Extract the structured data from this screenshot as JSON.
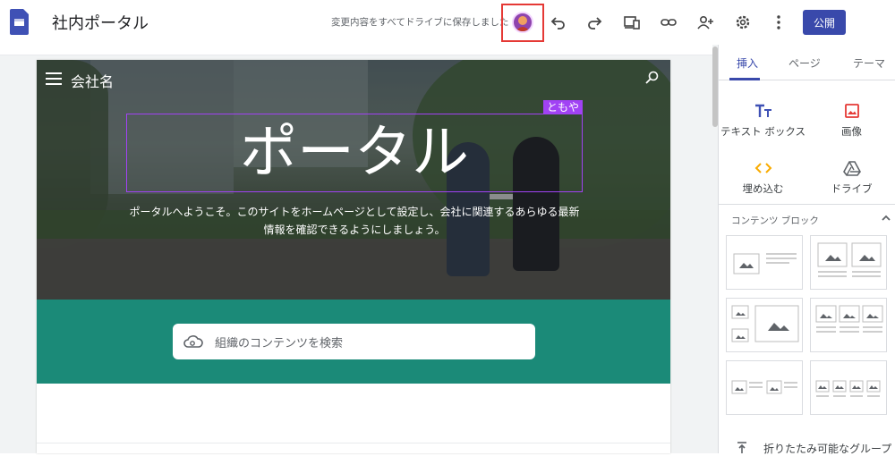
{
  "app": {
    "title": "社内ポータル",
    "save_status": "変更内容をすべてドライブに保存しました",
    "publish_label": "公開"
  },
  "toolbar": {
    "icons": [
      "undo-icon",
      "redo-icon",
      "preview-icon",
      "link-icon",
      "share-icon",
      "settings-icon",
      "more-icon"
    ]
  },
  "site": {
    "company_name": "会社名",
    "hero_title": "ポータル",
    "editor_tag": "ともや",
    "hero_description_line1": "ポータルへようこそ。このサイトをホームページとして設定し、会社に関連するあらゆる最新",
    "hero_description_line2": "情報を確認できるようにしましょう。",
    "search_placeholder": "組織のコンテンツを検索",
    "accent_color": "#1b8a78"
  },
  "panel": {
    "tabs": [
      "挿入",
      "ページ",
      "テーマ"
    ],
    "active_tab": "挿入",
    "tools": [
      {
        "label": "テキスト ボックス",
        "icon": "text-box-icon"
      },
      {
        "label": "画像",
        "icon": "image-icon"
      },
      {
        "label": "埋め込む",
        "icon": "embed-icon"
      },
      {
        "label": "ドライブ",
        "icon": "drive-icon"
      }
    ],
    "content_blocks_label": "コンテンツ ブロック",
    "collapsible_group_label": "折りたたみ可能なグループ"
  }
}
